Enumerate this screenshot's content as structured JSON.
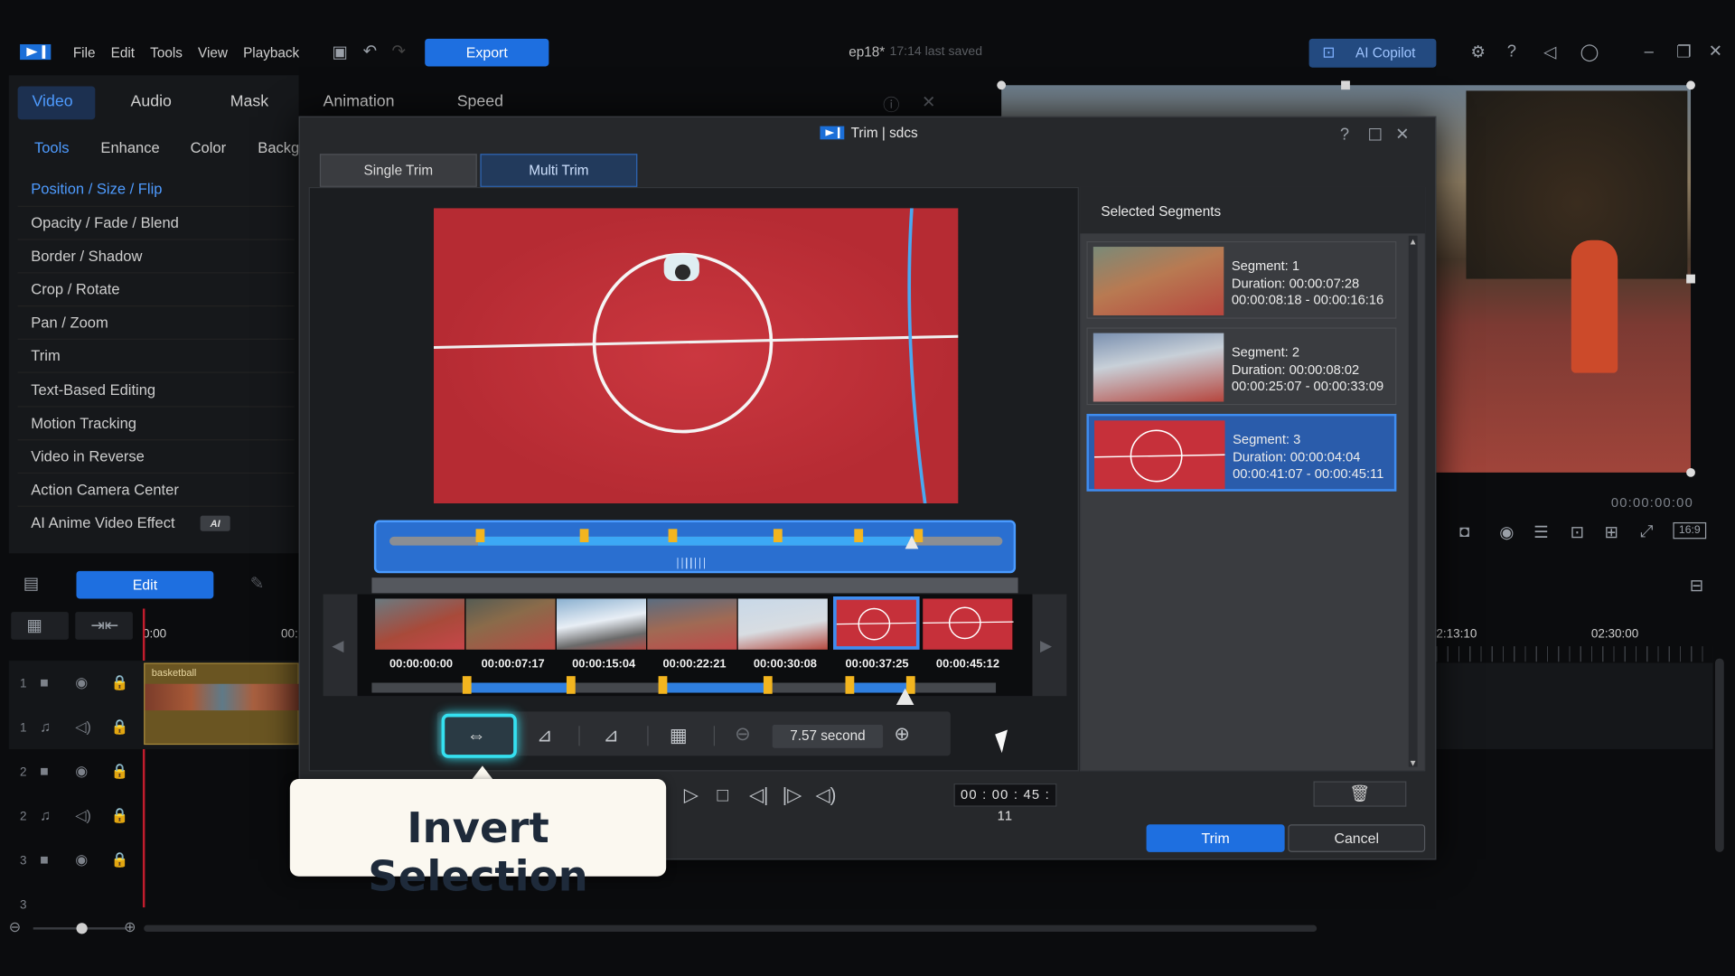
{
  "menu": [
    "File",
    "Edit",
    "Tools",
    "View",
    "Playback"
  ],
  "export_label": "Export",
  "project_title": "ep18*",
  "saved_text": "17:14 last saved",
  "copilot_label": "AI Copilot",
  "panel_tabs": [
    "Video",
    "Audio",
    "Mask",
    "Animation",
    "Speed"
  ],
  "sub_tabs": [
    "Tools",
    "Enhance",
    "Color",
    "Backg"
  ],
  "tools": [
    "Position / Size / Flip",
    "Opacity / Fade / Blend",
    "Border / Shadow",
    "Crop / Rotate",
    "Pan / Zoom",
    "Trim",
    "Text-Based Editing",
    "Motion Tracking",
    "Video in Reverse",
    "Action Camera Center",
    "AI Anime Video Effect"
  ],
  "ai_badge": "AI",
  "edit_label": "Edit",
  "ruler": [
    "0:00",
    "00:",
    "2:13:10",
    "02:30:00"
  ],
  "clip_label": "basketball",
  "tracks": [
    "1",
    "1",
    "2",
    "2",
    "3",
    "3"
  ],
  "preview_time": "00:00:00:00",
  "aspect": "16:9",
  "dialog": {
    "title": "Trim | sdcs",
    "tabs": [
      "Single Trim",
      "Multi Trim"
    ],
    "selected_title": "Selected Segments",
    "segments": [
      {
        "name": "Segment: 1",
        "duration": "Duration: 00:00:07:28",
        "range": "00:00:08:18 - 00:00:16:16"
      },
      {
        "name": "Segment: 2",
        "duration": "Duration: 00:00:08:02",
        "range": "00:00:25:07 - 00:00:33:09"
      },
      {
        "name": "Segment: 3",
        "duration": "Duration: 00:00:04:04",
        "range": "00:00:41:07 - 00:00:45:11"
      }
    ],
    "timecodes": [
      "00:00:00:00",
      "00:00:07:17",
      "00:00:15:04",
      "00:00:22:21",
      "00:00:30:08",
      "00:00:37:25",
      "00:00:45:12"
    ],
    "zoom_value": "7.57 second",
    "current_time": "00 : 00 : 45 : 11",
    "trim_label": "Trim",
    "cancel_label": "Cancel"
  },
  "tooltip": "Invert Selection",
  "colors": {
    "accent": "#1e6fe0",
    "court": "#c8303a",
    "marker": "#f3b51f",
    "glow": "#35e0f0"
  }
}
